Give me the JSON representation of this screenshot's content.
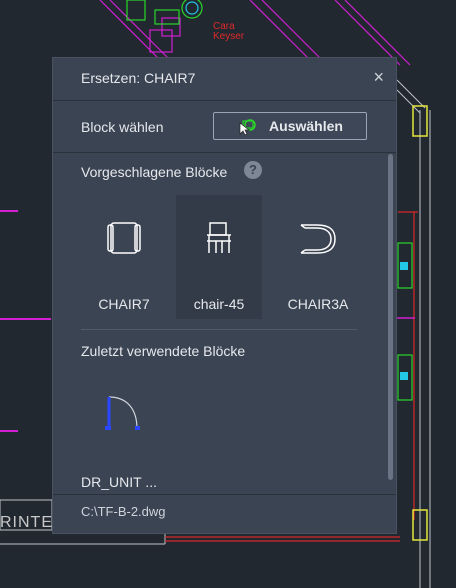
{
  "background": {
    "name_line1": "Cara",
    "name_line2": "Keyser",
    "printer_text": "RINTE"
  },
  "dialog": {
    "title": "Ersetzen: CHAIR7",
    "close_glyph": "×",
    "block_label": "Block wählen",
    "select_button": "Auswählen",
    "suggested_heading": "Vorgeschlagene Blöcke",
    "help_glyph": "?",
    "suggested": [
      {
        "label": "CHAIR7",
        "icon": "chair7-icon",
        "selected": false
      },
      {
        "label": "chair-45",
        "icon": "chair-45-icon",
        "selected": true
      },
      {
        "label": "CHAIR3A",
        "icon": "chair3a-icon",
        "selected": false
      }
    ],
    "recent_heading": "Zuletzt verwendete Blöcke",
    "recent": [
      {
        "label": "DR_UNIT ...",
        "icon": "door-unit-icon"
      }
    ],
    "footer_path": "C:\\TF-B-2.dwg"
  },
  "colors": {
    "panel": "#3b4453",
    "canvas": "#212830",
    "magenta": "#d21fd2",
    "green": "#2bd62b",
    "cyan": "#23c8e6",
    "yellow": "#e6e63a",
    "red": "#d62828",
    "door_blue": "#2b46ff"
  }
}
